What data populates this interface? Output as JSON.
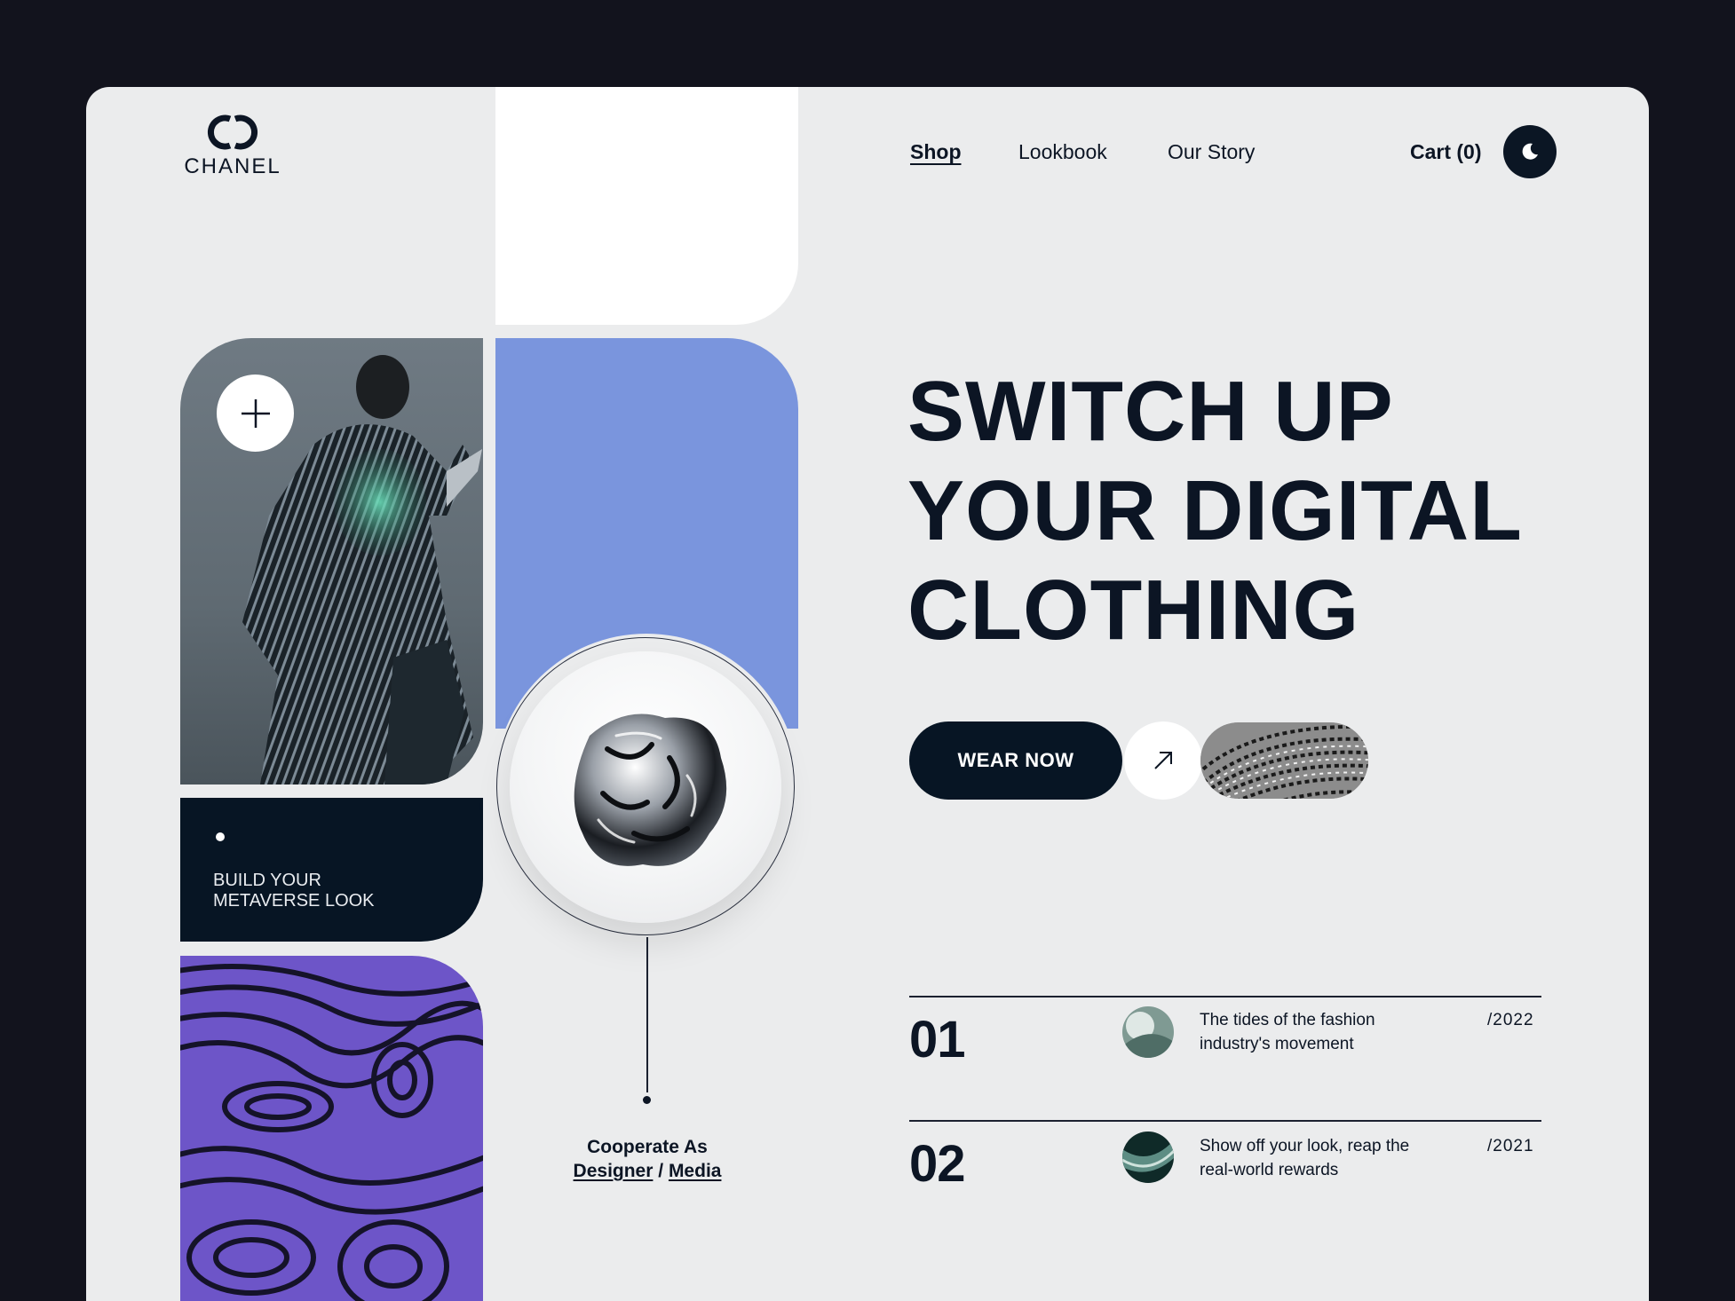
{
  "brand": {
    "name": "CHANEL"
  },
  "nav": {
    "items": [
      {
        "label": "Shop",
        "active": true
      },
      {
        "label": "Lookbook",
        "active": false
      },
      {
        "label": "Our Story",
        "active": false
      }
    ]
  },
  "cart": {
    "label": "Cart (0)"
  },
  "theme_toggle": {
    "icon": "moon-icon"
  },
  "cards": {
    "model": {
      "plus_icon": "plus-icon"
    },
    "dark": {
      "text": "BUILD YOUR METAVERSE LOOK"
    }
  },
  "cooperate": {
    "prefix": "Cooperate As",
    "link1": "Designer",
    "separator": " / ",
    "link2": "Media"
  },
  "hero": {
    "line1": "SWITCH UP",
    "line2": "YOUR DIGITAL",
    "line3": "CLOTHING"
  },
  "cta": {
    "label": "WEAR NOW",
    "arrow_icon": "arrow-up-right-icon"
  },
  "list": [
    {
      "num": "01",
      "text": "The tides of the fashion industry's movement",
      "year": "/2022"
    },
    {
      "num": "02",
      "text": "Show off your look, reap the real-world rewards",
      "year": "/2021"
    }
  ],
  "colors": {
    "dark": "#071524",
    "blue": "#7a95dd",
    "purple": "#6d55c8",
    "background": "#ebeced",
    "page": "#12131d"
  }
}
